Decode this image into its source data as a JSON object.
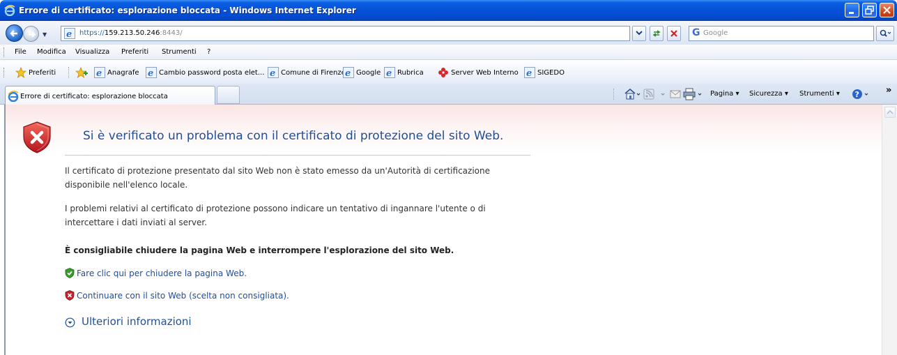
{
  "window": {
    "title": "Errore di certificato: esplorazione bloccata - Windows Internet Explorer"
  },
  "address_bar": {
    "url_prefix": "https://",
    "url_host": "159.213.50.246",
    "url_port": ":8443/",
    "search_placeholder": "Google",
    "search_engine_letter": "G"
  },
  "menu": [
    "File",
    "Modifica",
    "Visualizza",
    "Preferiti",
    "Strumenti",
    "?"
  ],
  "favorites": {
    "label": "Preferiti",
    "links": [
      "Anagrafe",
      "Cambio password posta elet...",
      "Comune di Firenze",
      "Google",
      "Rubrica",
      "Server Web Interno",
      "SIGEDO"
    ]
  },
  "tabs": {
    "active_label": "Errore di certificato: esplorazione bloccata"
  },
  "command_bar": {
    "page": "Pagina",
    "safety": "Sicurezza",
    "tools": "Strumenti",
    "chevron": "»"
  },
  "content": {
    "title": "Si è verificato un problema con il certificato di protezione del sito Web.",
    "para1": "Il certificato di protezione presentato dal sito Web non è stato emesso da un'Autorità di certificazione disponibile nell'elenco locale.",
    "para2": "I problemi relativi al certificato di protezione possono indicare un tentativo di ingannare l'utente o di intercettare i dati inviati al server.",
    "recommendation": "È consigliabile chiudere la pagina Web e interrompere l'esplorazione del sito Web.",
    "close_link": "Fare clic qui per chiudere la pagina Web.",
    "continue_link": "Continuare con il sito Web (scelta non consigliata).",
    "more_info": "Ulteriori informazioni"
  },
  "colors": {
    "titlebar": "#0551d8",
    "link": "#1f4e9a",
    "error_red": "#c8232c",
    "safe_green": "#3a9a2e"
  }
}
